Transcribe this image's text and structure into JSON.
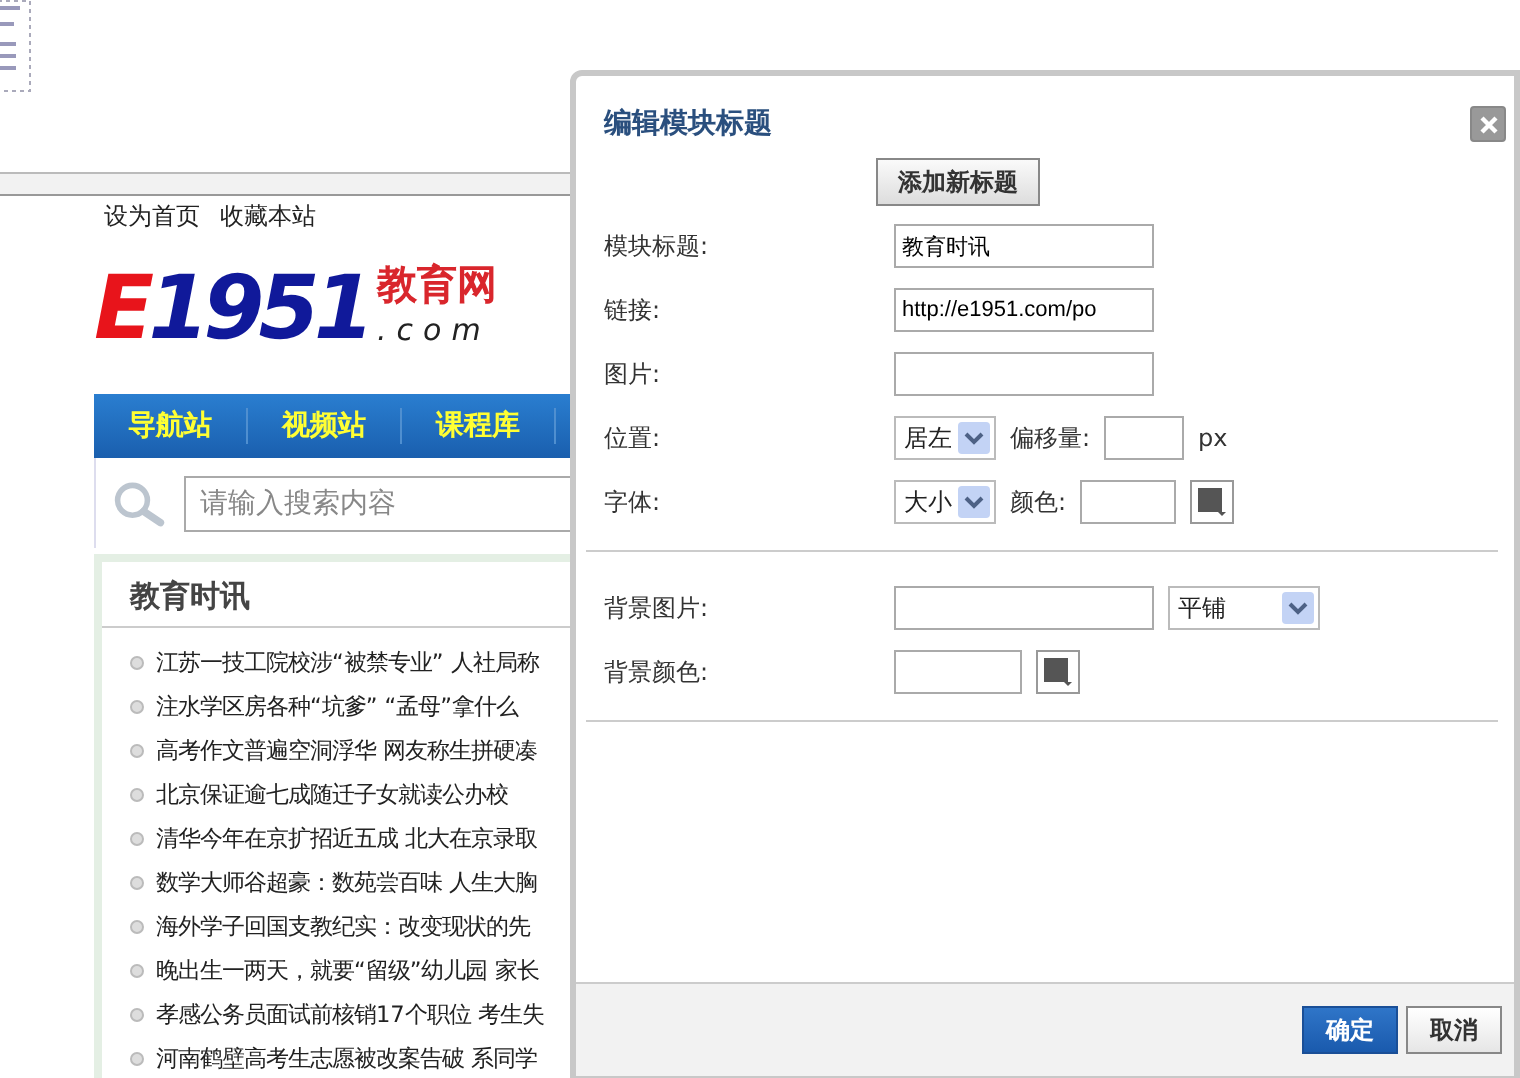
{
  "page": {
    "top_links": [
      "设为首页",
      "收藏本站"
    ],
    "logo": {
      "letter": "E",
      "number": "1951",
      "suffix": "教育网",
      "domain": ".com"
    },
    "nav": [
      "导航站",
      "视频站",
      "课程库"
    ],
    "search": {
      "placeholder": "请输入搜索内容"
    },
    "news": {
      "title": "教育时讯",
      "items": [
        "江苏一技工院校涉“被禁专业” 人社局称",
        "注水学区房各种“坑爹” “孟母”拿什么",
        "高考作文普遍空洞浮华 网友称生拼硬凑",
        "北京保证逾七成随迁子女就读公办校",
        "清华今年在京扩招近五成 北大在京录取",
        "数学大师谷超豪：数苑尝百味 人生大胸",
        "海外学子回国支教纪实：改变现状的先",
        "晚出生一两天，就要“留级”幼儿园 家长",
        "孝感公务员面试前核销17个职位 考生失",
        "河南鹤壁高考生志愿被改案告破 系同学"
      ]
    }
  },
  "dialog": {
    "title": "编辑模块标题",
    "add_button": "添加新标题",
    "sections": [
      [
        {
          "label": "模块标题:",
          "controls": [
            {
              "kind": "input",
              "value": "教育时讯"
            }
          ]
        },
        {
          "label": "链接:",
          "controls": [
            {
              "kind": "input",
              "value": "http://e1951.com/po"
            }
          ]
        },
        {
          "label": "图片:",
          "controls": [
            {
              "kind": "input"
            }
          ]
        },
        {
          "label": "位置:",
          "controls": [
            {
              "kind": "select",
              "value": "居左"
            },
            {
              "kind": "label",
              "text": "偏移量:"
            },
            {
              "kind": "small_input"
            },
            {
              "kind": "label",
              "text": "px"
            }
          ]
        },
        {
          "label": "字体:",
          "controls": [
            {
              "kind": "select",
              "value": "大小"
            },
            {
              "kind": "label",
              "text": "颜色:"
            },
            {
              "kind": "color_input"
            },
            {
              "kind": "swatch"
            }
          ]
        }
      ],
      [
        {
          "label": "背景图片:",
          "controls": [
            {
              "kind": "input"
            },
            {
              "kind": "wide_select",
              "value": "平铺"
            }
          ]
        },
        {
          "label": "背景颜色:",
          "controls": [
            {
              "kind": "bg_color_input"
            },
            {
              "kind": "swatch"
            }
          ]
        }
      ]
    ],
    "buttons": [
      {
        "label": "确定",
        "primary": true
      },
      {
        "label": "取消",
        "primary": false
      }
    ]
  }
}
